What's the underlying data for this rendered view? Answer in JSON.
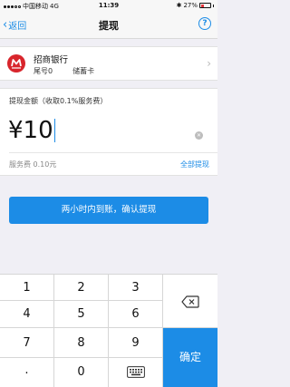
{
  "status_bar": {
    "carrier": "中国移动",
    "network": "4G",
    "time": "11:39",
    "battery": "27%"
  },
  "nav": {
    "back_label": "返回",
    "title": "提现",
    "help_icon": "?"
  },
  "bank": {
    "name": "招商银行",
    "tail": "尾号0",
    "card_type": "储蓄卡"
  },
  "amount": {
    "label": "提现金额（收取0.1%服务费）",
    "currency": "¥",
    "value": "10",
    "fee": "服务费 0.10元",
    "withdraw_all": "全部提现"
  },
  "confirm_button": "两小时内到账，确认提现",
  "keypad": {
    "keys": [
      "1",
      "2",
      "3",
      "4",
      "5",
      "6",
      "7",
      "8",
      "9",
      ".",
      "0"
    ],
    "ok_label": "确定"
  },
  "colors": {
    "accent": "#1c8ce6",
    "bank_red": "#d8252c",
    "background": "#f0eff5"
  }
}
